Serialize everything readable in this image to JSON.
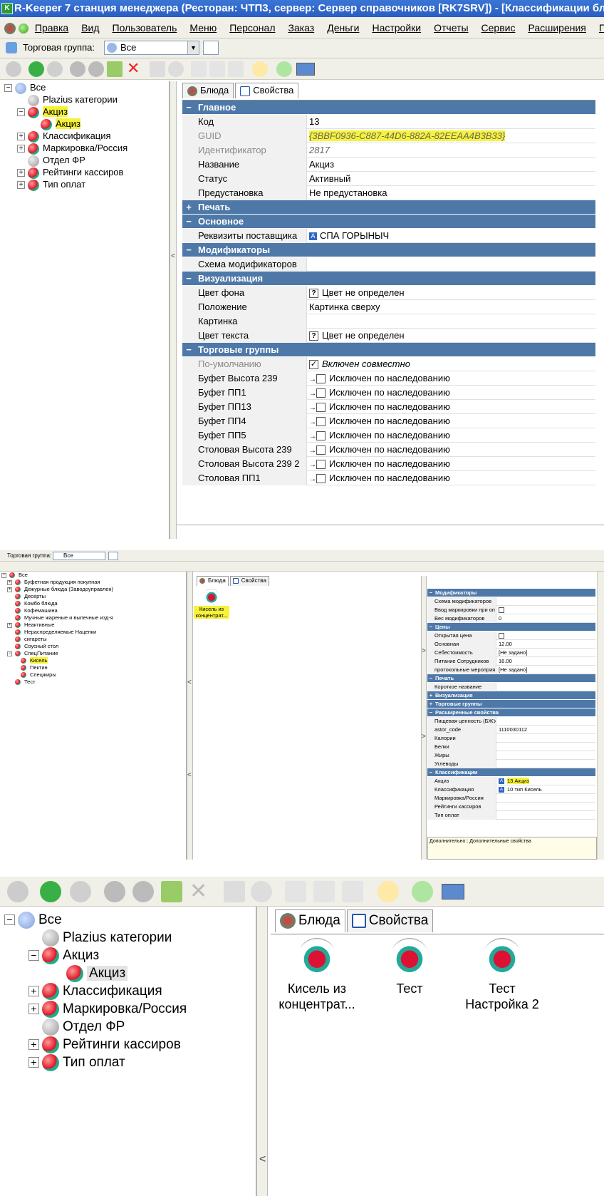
{
  "window": {
    "title": "R-Keeper 7 станция менеджера (Ресторан: ЧТП3, сервер: Сервер справочников [RK7SRV]) - [Классификации блюд]",
    "app_icon_letter": "K"
  },
  "menu": [
    "Правка",
    "Вид",
    "Пользователь",
    "Меню",
    "Персонал",
    "Заказ",
    "Деньги",
    "Настройки",
    "Отчеты",
    "Сервис",
    "Расширения",
    "Помощ"
  ],
  "trade_group": {
    "label": "Торговая группа:",
    "value": "Все"
  },
  "panel1": {
    "tree": [
      {
        "label": "Все",
        "icon": "house-icon",
        "expander": "−"
      },
      {
        "label": "Plazius категории",
        "icon": "category-grey-icon",
        "expander": ""
      },
      {
        "label": "Акциз",
        "icon": "category-icon",
        "expander": "−",
        "highlight": true
      },
      {
        "label": "Акциз",
        "icon": "category-icon",
        "expander": "",
        "highlight": true,
        "selected": true
      },
      {
        "label": "Классификация",
        "icon": "category-icon",
        "expander": "+"
      },
      {
        "label": "Маркировка/Россия",
        "icon": "category-icon",
        "expander": "+"
      },
      {
        "label": "Отдел ФР",
        "icon": "category-grey-icon",
        "expander": ""
      },
      {
        "label": "Рейтинги кассиров",
        "icon": "category-icon",
        "expander": "+"
      },
      {
        "label": "Тип оплат",
        "icon": "category-icon",
        "expander": "+"
      }
    ],
    "tabs": [
      "Блюда",
      "Свойства"
    ],
    "props": [
      {
        "type": "section",
        "glyph": "−",
        "label": "Главное"
      },
      {
        "label": "Код",
        "value": "13"
      },
      {
        "label": "GUID",
        "value": "{3BBF0936-C887-44D6-882A-82EEAA4B3B33}",
        "dim": true,
        "highlight": true
      },
      {
        "label": "Идентификатор",
        "value": "2817",
        "dim": true
      },
      {
        "label": "Название",
        "value": "Акциз"
      },
      {
        "label": "Статус",
        "value": "Активный"
      },
      {
        "label": "Предустановка",
        "value": "Не предустановка"
      },
      {
        "type": "section",
        "glyph": "+",
        "label": "Печать"
      },
      {
        "type": "section",
        "glyph": "−",
        "label": "Основное"
      },
      {
        "label": "Реквизиты поставщика",
        "value": "СПА ГОРЫНЫЧ",
        "badge": "A"
      },
      {
        "type": "section",
        "glyph": "−",
        "label": "Модификаторы"
      },
      {
        "label": "Схема модификаторов",
        "value": ""
      },
      {
        "type": "section",
        "glyph": "−",
        "label": "Визуализация"
      },
      {
        "label": "Цвет фона",
        "value": "Цвет не определен",
        "qbox": "?"
      },
      {
        "label": "Положение",
        "value": "Картинка сверху"
      },
      {
        "label": "Картинка",
        "value": ""
      },
      {
        "label": "Цвет текста",
        "value": "Цвет не определен",
        "qbox": "?"
      },
      {
        "type": "section",
        "glyph": "−",
        "label": "Торговые группы"
      },
      {
        "label": "По-умолчанию",
        "value": "Включен совместно",
        "check": "✓",
        "dim": true
      },
      {
        "label": "Буфет Высота 239",
        "value": "Исключен по наследованию",
        "check": "",
        "arrow": "→"
      },
      {
        "label": "Буфет ПП1",
        "value": "Исключен по наследованию",
        "check": "",
        "arrow": "→"
      },
      {
        "label": "Буфет ПП13",
        "value": "Исключен по наследованию",
        "check": "",
        "arrow": "→"
      },
      {
        "label": "Буфет ПП4",
        "value": "Исключен по наследованию",
        "check": "",
        "arrow": "→"
      },
      {
        "label": "Буфет ПП5",
        "value": "Исключен по наследованию",
        "check": "",
        "arrow": "→"
      },
      {
        "label": "Столовая Высота 239",
        "value": "Исключен по наследованию",
        "check": "",
        "arrow": "→"
      },
      {
        "label": "Столовая Высота 239 2",
        "value": "Исключен по наследованию",
        "check": "",
        "arrow": "→"
      },
      {
        "label": "Столовая ПП1",
        "value": "Исключен по наследованию",
        "check": "",
        "arrow": "→"
      }
    ]
  },
  "panel2": {
    "trade_group": {
      "label": "Торговая группа:",
      "value": "Все"
    },
    "tree": [
      {
        "label": "Все",
        "expander": "−"
      },
      {
        "label": "Буфетная продукция покупная",
        "expander": "+"
      },
      {
        "label": "Дежурные блюда (Заводоуправлен)",
        "expander": "+"
      },
      {
        "label": "Десерты",
        "expander": ""
      },
      {
        "label": "Комбо блюда",
        "expander": ""
      },
      {
        "label": "Кофемашина",
        "expander": ""
      },
      {
        "label": "Мучные жареные и выпечные изд-я",
        "expander": ""
      },
      {
        "label": "Неактивные",
        "expander": "+"
      },
      {
        "label": "Нераспределяемые Наценки",
        "expander": ""
      },
      {
        "label": "сигареты",
        "expander": ""
      },
      {
        "label": "Соусный стол",
        "expander": ""
      },
      {
        "label": "СпецПитание",
        "expander": "−"
      },
      {
        "label": "Кисель",
        "expander": "",
        "highlight": true
      },
      {
        "label": "Пектин",
        "expander": ""
      },
      {
        "label": "Спецжиры",
        "expander": ""
      },
      {
        "label": "Тест",
        "expander": ""
      }
    ],
    "tabs": [
      "Блюда",
      "Свойства"
    ],
    "dish": "Кисель из концентрат...",
    "props": [
      {
        "type": "section",
        "glyph": "−",
        "label": "Модификаторы"
      },
      {
        "label": "Схема модификаторов",
        "value": ""
      },
      {
        "label": "Ввод маркировки при оп",
        "value": "",
        "check": ""
      },
      {
        "label": "Вес модификаторов",
        "value": "0"
      },
      {
        "type": "section",
        "glyph": "−",
        "label": "Цены"
      },
      {
        "label": "Открытая цена",
        "value": "",
        "check": ""
      },
      {
        "label": "Основная",
        "value": "12.00"
      },
      {
        "label": "Себестоимость",
        "value": "[Не задано]"
      },
      {
        "label": "Питание Сотрудников",
        "value": "16.00"
      },
      {
        "label": "протокольные мероприя",
        "value": "[Не задано]"
      },
      {
        "type": "section",
        "glyph": "−",
        "label": "Печать"
      },
      {
        "label": "Короткое название",
        "value": ""
      },
      {
        "type": "section",
        "glyph": "+",
        "label": "Визуализация"
      },
      {
        "type": "section",
        "glyph": "+",
        "label": "Торговые группы"
      },
      {
        "type": "section",
        "glyph": "−",
        "label": "Расширенные свойства"
      },
      {
        "label": "Пищевая ценность (БЖУ",
        "value": ""
      },
      {
        "label": "astor_code",
        "value": "1110030112"
      },
      {
        "label": "Калории",
        "value": ""
      },
      {
        "label": "Белки",
        "value": ""
      },
      {
        "label": "Жиры",
        "value": ""
      },
      {
        "label": "Углеводы",
        "value": ""
      },
      {
        "type": "section",
        "glyph": "−",
        "label": "Классификации"
      },
      {
        "label": "Акциз",
        "value": "13 Акциз",
        "badge": "A",
        "highlight": true
      },
      {
        "label": "Классификация",
        "value": "10 тип Кисель",
        "badge": "A"
      },
      {
        "label": "Маркировка/Россия",
        "value": ""
      },
      {
        "label": "Рейтинги кассиров",
        "value": ""
      },
      {
        "label": "Тип оплат",
        "value": ""
      }
    ],
    "hint": "Дополнительно:: Дополнительные свойства"
  },
  "panel3": {
    "tree": [
      {
        "label": "Все",
        "icon": "house-icon",
        "expander": "−"
      },
      {
        "label": "Plazius категории",
        "icon": "category-grey-icon",
        "expander": ""
      },
      {
        "label": "Акциз",
        "icon": "category-icon",
        "expander": "−"
      },
      {
        "label": "Акциз",
        "icon": "category-icon",
        "expander": "",
        "selected": true
      },
      {
        "label": "Классификация",
        "icon": "category-icon",
        "expander": "+"
      },
      {
        "label": "Маркировка/Россия",
        "icon": "category-icon",
        "expander": "+"
      },
      {
        "label": "Отдел ФР",
        "icon": "category-grey-icon",
        "expander": ""
      },
      {
        "label": "Рейтинги кассиров",
        "icon": "category-icon",
        "expander": "+"
      },
      {
        "label": "Тип оплат",
        "icon": "category-icon",
        "expander": "+"
      }
    ],
    "tabs": [
      "Блюда",
      "Свойства"
    ],
    "dishes": [
      "Кисель из концентрат...",
      "Тест",
      "Тест Настройка 2"
    ]
  },
  "colors": {
    "section": "#4e78a8",
    "highlight": "#f6f23a",
    "title": "#2a5ec0"
  }
}
